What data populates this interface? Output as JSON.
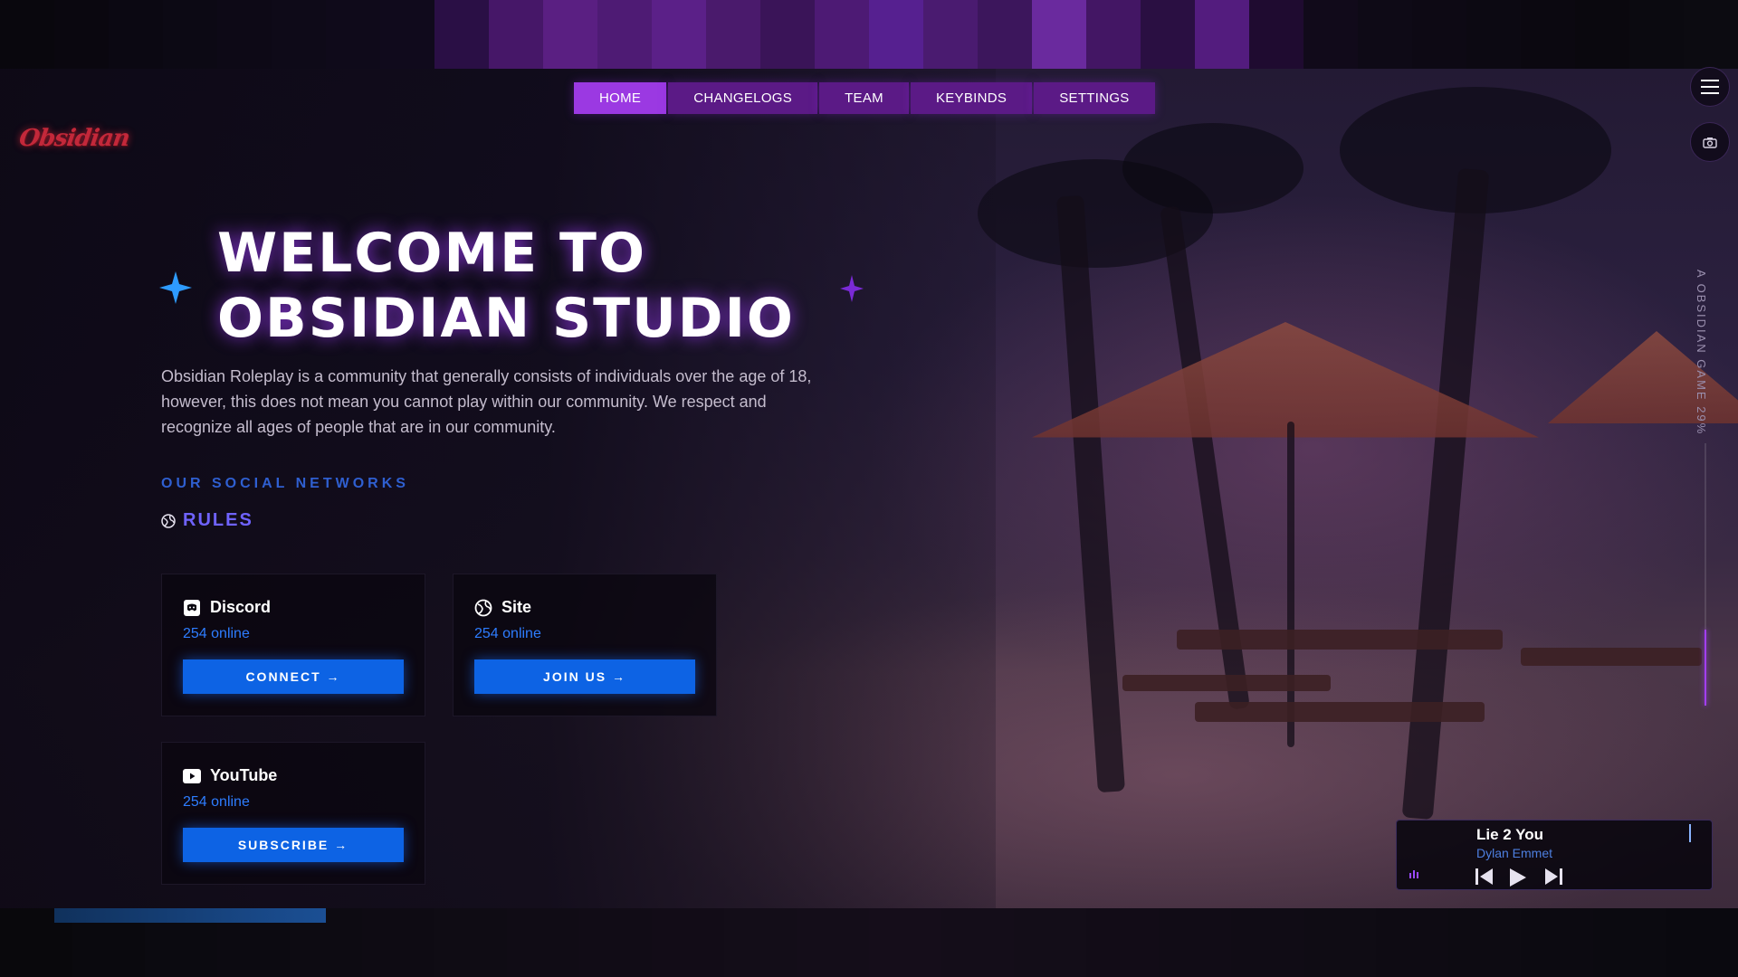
{
  "nav": {
    "tabs": [
      {
        "label": "HOME",
        "active": true
      },
      {
        "label": "CHANGELOGS",
        "active": false
      },
      {
        "label": "TEAM",
        "active": false
      },
      {
        "label": "KEYBINDS",
        "active": false
      },
      {
        "label": "SETTINGS",
        "active": false
      }
    ]
  },
  "logo": {
    "text": "Obsidian"
  },
  "hero": {
    "title_line1": "WELCOME TO",
    "title_line2": "OBSIDIAN STUDIO",
    "description": "Obsidian Roleplay is a community that generally consists of individuals over the age of 18, however, this does not mean you cannot play within our community. We respect and recognize all ages of people that are in our community."
  },
  "social": {
    "heading": "OUR SOCIAL NETWORKS",
    "rules_label": "RULES",
    "cards": [
      {
        "name": "Discord",
        "status": "254 online",
        "button": "CONNECT →",
        "icon": "discord-icon"
      },
      {
        "name": "Site",
        "status": "254 online",
        "button": "JOIN US →",
        "icon": "globe-icon"
      },
      {
        "name": "YouTube",
        "status": "254 online",
        "button": "SUBSCRIBE →",
        "icon": "youtube-icon"
      }
    ]
  },
  "sidebar": {
    "vertical_text": "A OBSIDIAN GAME 29%",
    "progress_percent": 29
  },
  "player": {
    "title": "Lie 2 You",
    "artist": "Dylan Emmet"
  },
  "colors": {
    "accent_purple": "#9b39e2",
    "nav_tab": "#5b1a86",
    "button_blue": "#0d63e4",
    "status_blue": "#2e7dff"
  }
}
